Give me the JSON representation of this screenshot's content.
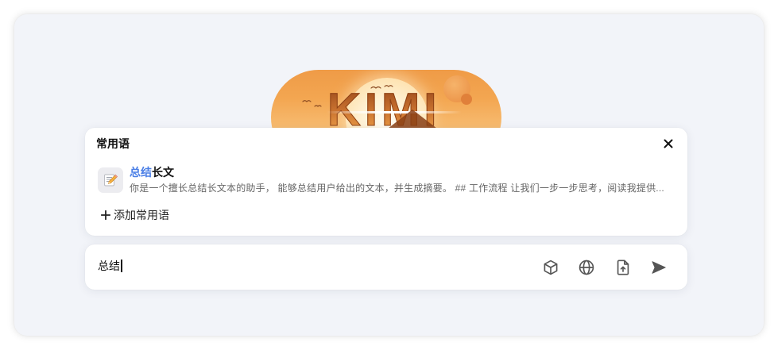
{
  "app": {
    "logo_text": "KIMI",
    "logo_icon": "kimi-logo"
  },
  "colors": {
    "window_background": "#f2f4f9",
    "highlight": "#4b7fe6",
    "icon": "#555555",
    "logo_orange": "#f3a24f"
  },
  "phrases_panel": {
    "title": "常用语",
    "close_icon": "close-icon",
    "items": [
      {
        "icon": "memo-icon",
        "title_highlight": "总结",
        "title_rest": "长文",
        "description": "你是一个擅长总结长文本的助手， 能够总结用户给出的文本，并生成摘要。 ## 工作流程 让我们一步一步思考，阅读我提供..."
      }
    ],
    "add_phrase": {
      "icon": "plus-icon",
      "label": "添加常用语"
    }
  },
  "composer": {
    "value": "总结",
    "tools": [
      {
        "icon": "cube-icon"
      },
      {
        "icon": "globe-icon"
      },
      {
        "icon": "file-upload-icon"
      },
      {
        "icon": "send-icon"
      }
    ]
  }
}
